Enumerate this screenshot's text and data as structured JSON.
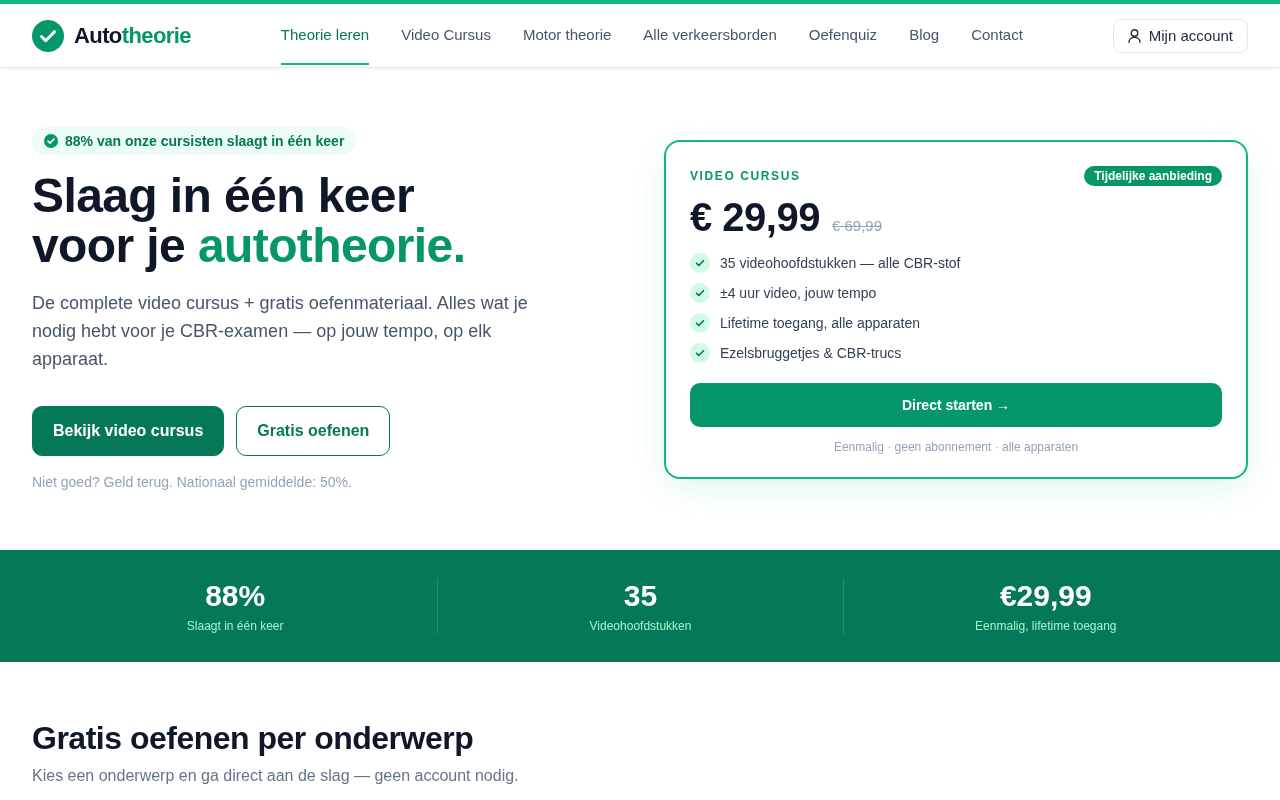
{
  "header": {
    "logo": {
      "text_main": "Auto",
      "text_accent": "theorie"
    },
    "nav": [
      {
        "label": "Theorie leren",
        "selected": true
      },
      {
        "label": "Video Cursus",
        "selected": false
      },
      {
        "label": "Motor theorie",
        "selected": false
      },
      {
        "label": "Alle verkeersborden",
        "selected": false
      },
      {
        "label": "Oefenquiz",
        "selected": false
      },
      {
        "label": "Blog",
        "selected": false
      },
      {
        "label": "Contact",
        "selected": false
      }
    ],
    "account_button": "Mijn account"
  },
  "hero": {
    "badge": "88% van onze cursisten slaagt in één keer",
    "heading_line_1": "Slaag in één keer",
    "heading_line_2": "voor je",
    "heading_accent": "autotheorie.",
    "lead": "De complete video cursus + gratis oefenmateriaal. Alles wat je nodig hebt voor je CBR-examen — op jouw tempo, op elk apparaat.",
    "buttons": [
      {
        "label": "Bekijk video cursus",
        "kind": "primary"
      },
      {
        "label": "Gratis oefenen",
        "kind": "outline"
      }
    ],
    "note": "Niet goed? Geld terug. Nationaal gemiddelde: 50%."
  },
  "offer_card": {
    "eyebrow": "VIDEO CURSUS",
    "tag": "Tijdelijke aanbieding",
    "price": "€ 29,99",
    "old_price": "€ 69,99",
    "features": [
      "35 videohoofdstukken — alle CBR-stof",
      "±4 uur video, jouw tempo",
      "Lifetime toegang, alle apparaten",
      "Ezelsbruggetjes & CBR-trucs"
    ],
    "cta": "Direct starten →",
    "footnote": "Eenmalig · geen abonnement · alle apparaten"
  },
  "stats": [
    {
      "value": "88%",
      "label": "Slaagt in één keer"
    },
    {
      "value": "35",
      "label": "Videohoofdstukken"
    },
    {
      "value": "€29,99",
      "label": "Eenmalig, lifetime toegang"
    }
  ],
  "topics_section": {
    "title": "Gratis oefenen per onderwerp",
    "subtitle": "Kies een onderwerp en ga direct aan de slag — geen account nodig."
  }
}
